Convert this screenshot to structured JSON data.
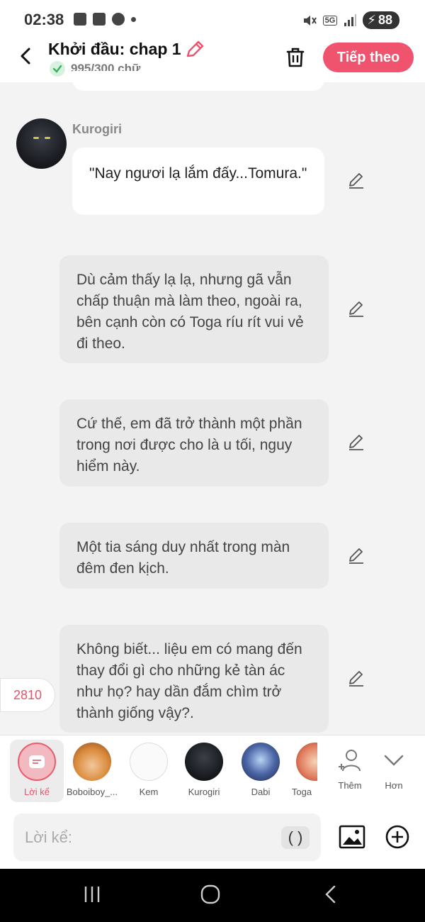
{
  "status_bar": {
    "time": "02:38",
    "battery": "88",
    "network": "5G"
  },
  "header": {
    "title": "Khởi đầu: chap 1",
    "word_count": "995/300 chữ",
    "next_label": "Tiếp theo"
  },
  "messages": [
    {
      "type": "character",
      "speaker": "Kurogiri",
      "text": "\"Nay ngươi lạ lắm đấy...Tomura.\""
    },
    {
      "type": "narration",
      "text": "Dù cảm thấy lạ lạ, nhưng gã vẫn chấp thuận mà làm theo, ngoài ra, bên cạnh còn có Toga ríu rít vui vẻ đi theo."
    },
    {
      "type": "narration",
      "text": "Cứ thế, em đã trở thành một phần trong nơi được cho là u tối, nguy hiểm này."
    },
    {
      "type": "narration",
      "text": "Một tia sáng duy nhất trong màn đêm đen kịch."
    },
    {
      "type": "narration",
      "text": "Không biết... liệu em có mang đến thay đổi gì cho những kẻ tàn ác như họ? hay dần đắm chìm trở thành giống vậy?."
    }
  ],
  "counter": "2810",
  "characters": [
    {
      "label": "Lời kể"
    },
    {
      "label": "Boboiboy_..."
    },
    {
      "label": "Kem"
    },
    {
      "label": "Kurogiri"
    },
    {
      "label": "Dabi"
    },
    {
      "label": "Toga"
    }
  ],
  "actions": {
    "add_label": "Thêm",
    "more_label": "Hơn"
  },
  "input": {
    "placeholder": "Lời kể:",
    "paren": "( )"
  },
  "colors": {
    "accent": "#f0536e",
    "narration_bg": "#e9e9e9"
  }
}
